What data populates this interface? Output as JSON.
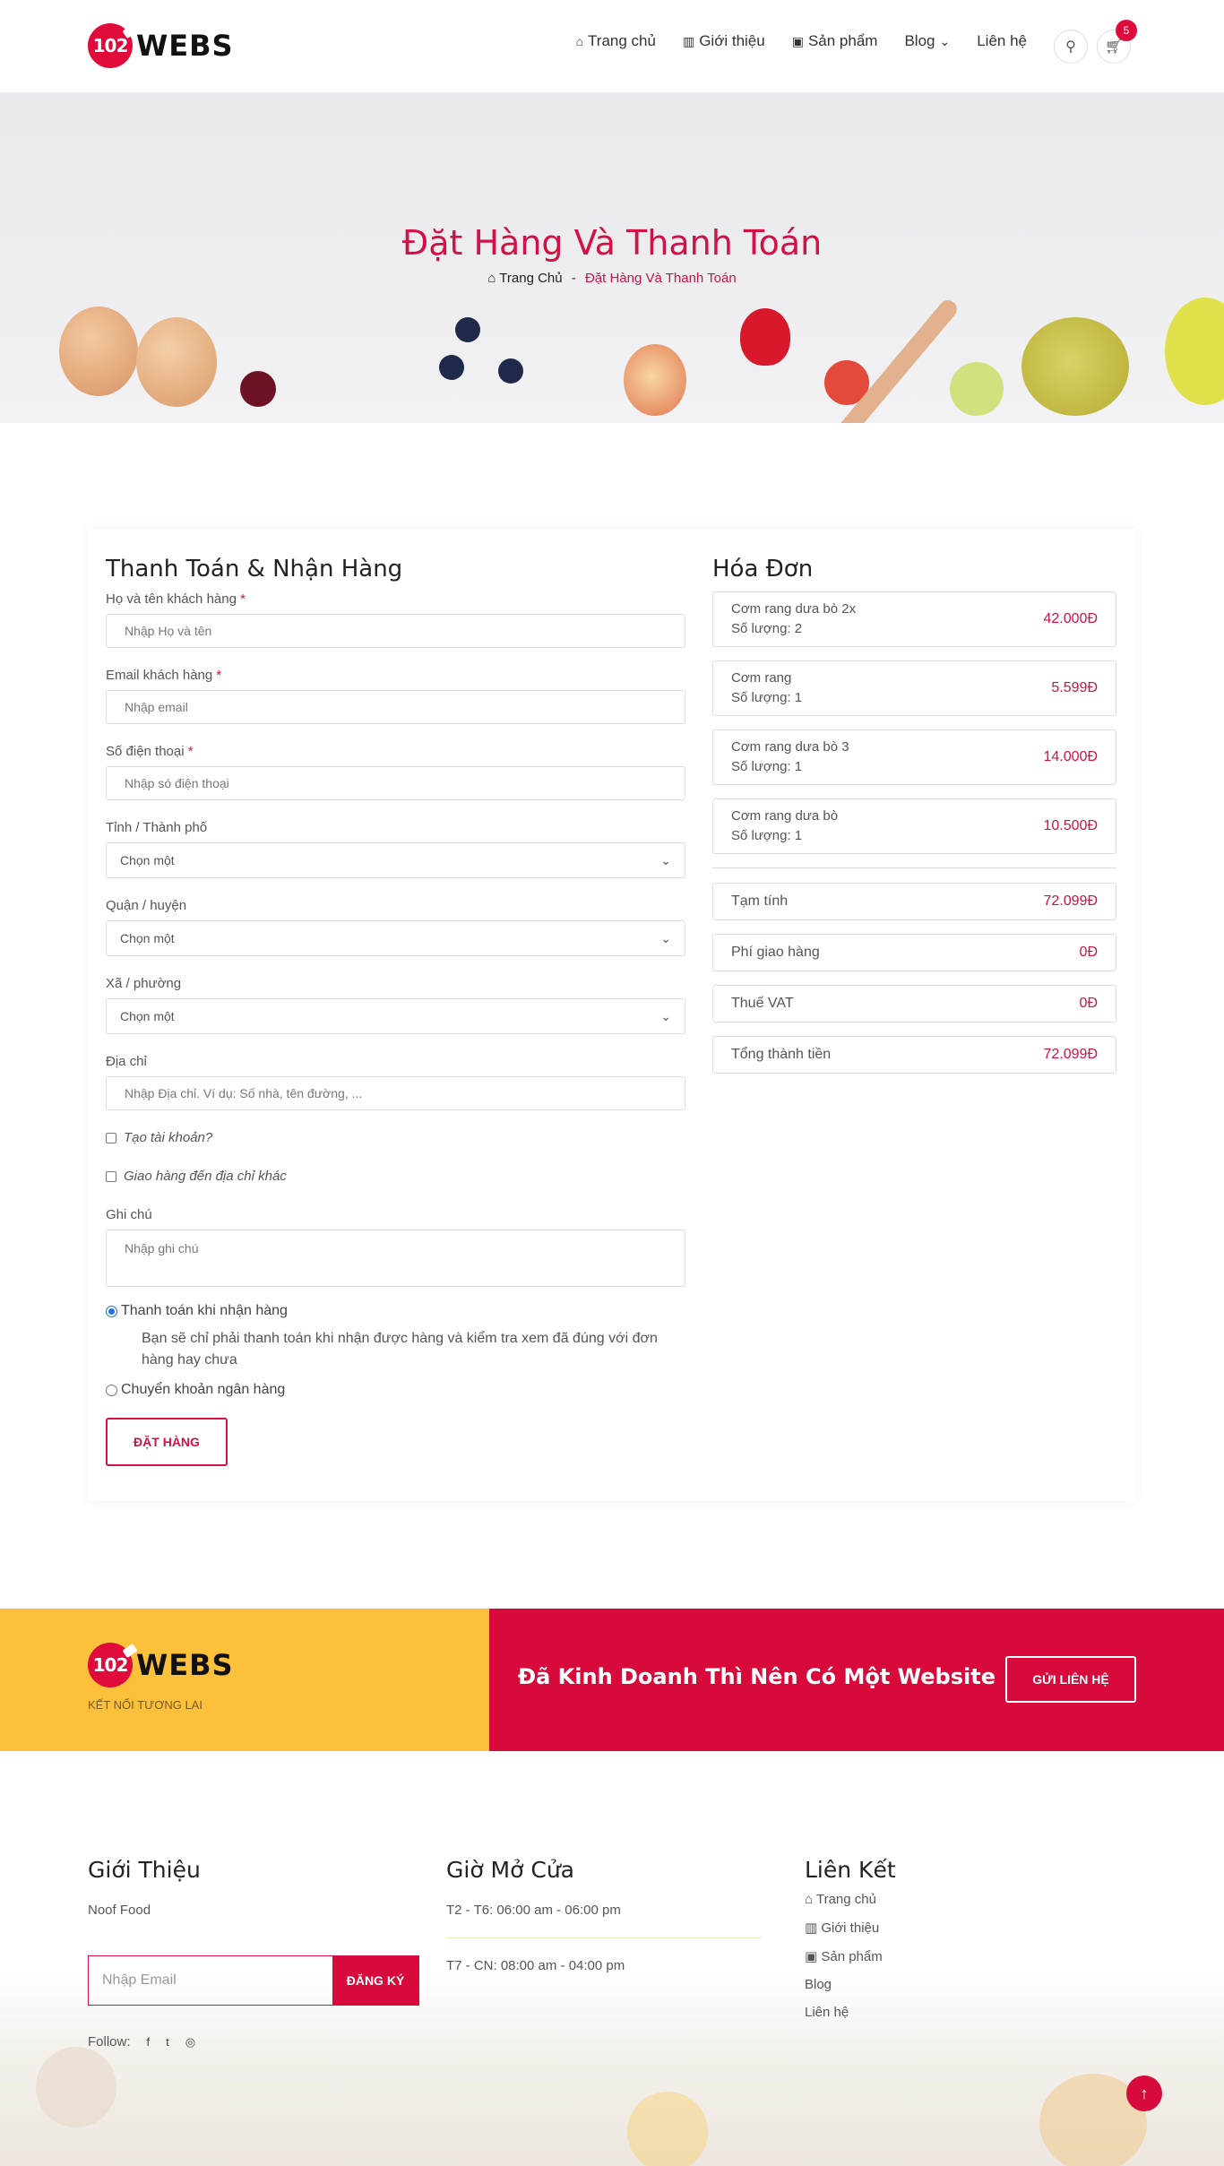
{
  "header": {
    "logo_mark": "102",
    "logo_text": "WEBS",
    "nav": [
      {
        "label": "Trang chủ",
        "icon": "home-icon"
      },
      {
        "label": "Giới thiệu",
        "icon": "cake-icon"
      },
      {
        "label": "Sản phẩm",
        "icon": "bag-icon"
      },
      {
        "label": "Blog",
        "icon": "chevron-down-icon"
      },
      {
        "label": "Liên hệ",
        "icon": ""
      }
    ],
    "cart_count": "5"
  },
  "banner": {
    "title": "Đặt Hàng Và Thanh Toán",
    "breadcrumb_home": "Trang Chủ",
    "breadcrumb_sep": "-",
    "breadcrumb_current": "Đặt Hàng Và Thanh Toán"
  },
  "form": {
    "title": "Thanh Toán & Nhận Hàng",
    "name_label": "Họ và tên khách hàng",
    "name_placeholder": "Nhập Họ và tên",
    "email_label": "Email khách hàng",
    "email_placeholder": "Nhập email",
    "phone_label": "Số điện thoại",
    "phone_placeholder": "Nhập só điện thoại",
    "required_mark": "*",
    "province_label": "Tỉnh / Thành phố",
    "district_label": "Quận / huyện",
    "ward_label": "Xã / phường",
    "select_value": "Chọn một",
    "address_label": "Địa chỉ",
    "address_placeholder": "Nhập Địa chỉ. Ví dụ: Số nhà, tên đường, ...",
    "create_account": "Tạo tài khoản?",
    "ship_other": "Giao hàng đến địa chỉ khác",
    "note_label": "Ghi chú",
    "note_placeholder": "Nhập ghi chú",
    "pay_cod": "Thanh toán khi nhận hàng",
    "pay_cod_desc": "Bạn sẽ chỉ phải thanh toán khi nhận được hàng và kiểm tra xem đã đúng với đơn hàng hay chưa",
    "pay_bank": "Chuyển khoản ngân hàng",
    "submit": "ĐẶT HÀNG"
  },
  "invoice": {
    "title": "Hóa Đơn",
    "items": [
      {
        "name": "Cơm rang dưa bò 2x",
        "qty": "Số lượng: 2",
        "price": "42.000Đ"
      },
      {
        "name": "Cơm rang",
        "qty": "Số lượng: 1",
        "price": "5.599Đ"
      },
      {
        "name": "Cơm rang dưa bò 3",
        "qty": "Số lượng: 1",
        "price": "14.000Đ"
      },
      {
        "name": "Cơm rang dưa bò",
        "qty": "Số lượng: 1",
        "price": "10.500Đ"
      }
    ],
    "summary": [
      {
        "label": "Tạm tính",
        "value": "72.099Đ"
      },
      {
        "label": "Phí giao hàng",
        "value": "0Đ"
      },
      {
        "label": "Thuế VAT",
        "value": "0Đ"
      },
      {
        "label": "Tổng thành tiền",
        "value": "72.099Đ"
      }
    ]
  },
  "cta": {
    "logo_mark": "102",
    "logo_text": "WEBS",
    "tagline": "KẾT NỐI TƯƠNG LAI",
    "text": "Đã Kinh Doanh Thì Nên Có Một Website",
    "button": "GỬI LIÊN HỆ"
  },
  "footer": {
    "about_title": "Giới Thiệu",
    "about_text": "Noof Food",
    "email_placeholder": "Nhập Email",
    "subscribe": "ĐĂNG KÝ",
    "follow": "Follow:",
    "hours_title": "Giờ Mở Cửa",
    "hours": [
      "T2 - T6: 06:00 am - 06:00 pm",
      "T7 - CN: 08:00 am - 04:00 pm"
    ],
    "links_title": "Liên Kết",
    "links": [
      "Trang chủ",
      "Giới thiệu",
      "Sản phẩm",
      "Blog",
      "Liên hệ"
    ]
  },
  "colors": {
    "accent": "#d31145",
    "cta_yellow": "#fdc03b",
    "cta_red": "#d80a3b"
  }
}
